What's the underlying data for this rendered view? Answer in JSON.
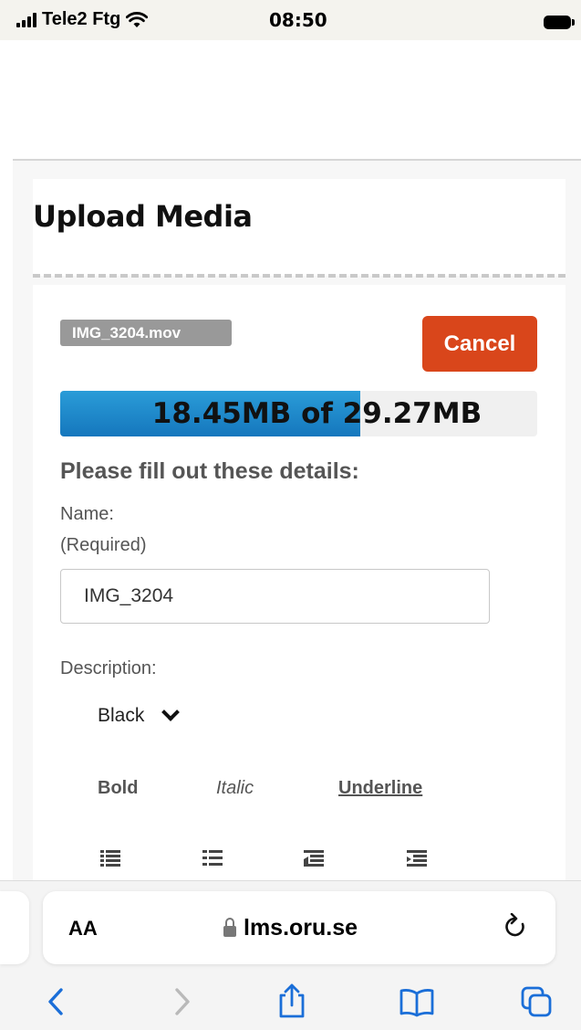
{
  "status_bar": {
    "carrier": "Tele2 Ftg",
    "time": "08:50"
  },
  "page": {
    "title": "Upload Media",
    "file_name": "IMG_3204.mov",
    "cancel_label": "Cancel",
    "progress": {
      "text": "18.45MB of 29.27MB",
      "fraction": 0.63
    },
    "section_title": "Please fill out these details:",
    "name_label": "Name:",
    "name_required": "(Required)",
    "name_value": "IMG_3204",
    "description_label": "Description:",
    "color_select": {
      "value": "Black"
    },
    "format": {
      "bold": "Bold",
      "italic": "Italic",
      "underline": "Underline"
    },
    "toolbar_icons": [
      "ordered-list-icon",
      "unordered-list-icon",
      "outdent-icon",
      "indent-icon"
    ]
  },
  "safari": {
    "text_size_label": "AA",
    "url": "lms.oru.se",
    "nav_icons": [
      "back-icon",
      "forward-icon",
      "share-icon",
      "bookmarks-icon",
      "tabs-icon"
    ]
  },
  "colors": {
    "accent": "#d9461b",
    "progress": "#1a87c9",
    "chip": "#999999",
    "link": "#1a6ed8"
  }
}
